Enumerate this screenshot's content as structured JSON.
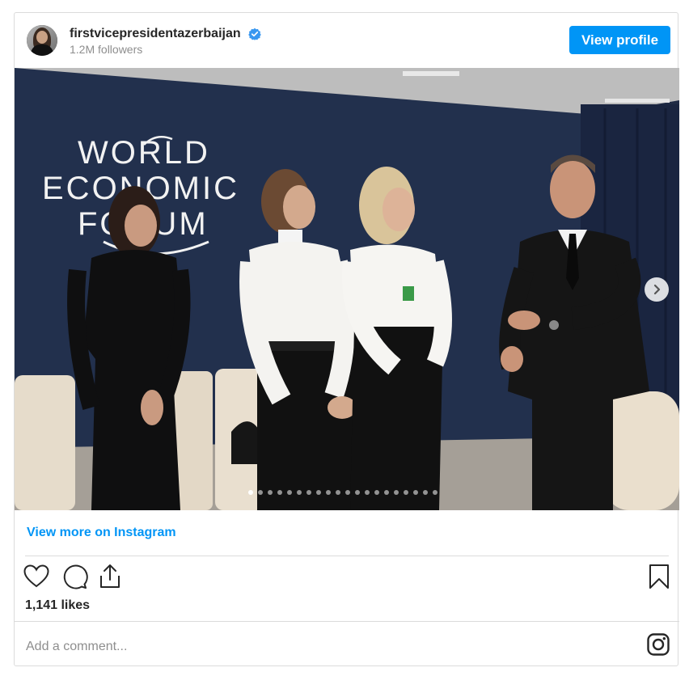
{
  "header": {
    "username": "firstvicepresidentazerbaijan",
    "followers": "1.2M followers",
    "view_profile_label": "View profile"
  },
  "media": {
    "sign_lines": [
      "WORLD",
      "ECONOMIC",
      "FORUM"
    ],
    "carousel_dot_count": 20,
    "active_dot_index": 0
  },
  "links": {
    "view_more": "View more on Instagram"
  },
  "stats": {
    "likes": "1,141 likes"
  },
  "comment": {
    "placeholder": "Add a comment..."
  },
  "colors": {
    "accent": "#0095f6",
    "border": "#dbdbdb",
    "text": "#262626",
    "muted": "#8e8e8e"
  },
  "icons": [
    "verified-badge-icon",
    "chevron-right-icon",
    "heart-icon",
    "comment-icon",
    "share-icon",
    "bookmark-icon",
    "instagram-icon"
  ]
}
